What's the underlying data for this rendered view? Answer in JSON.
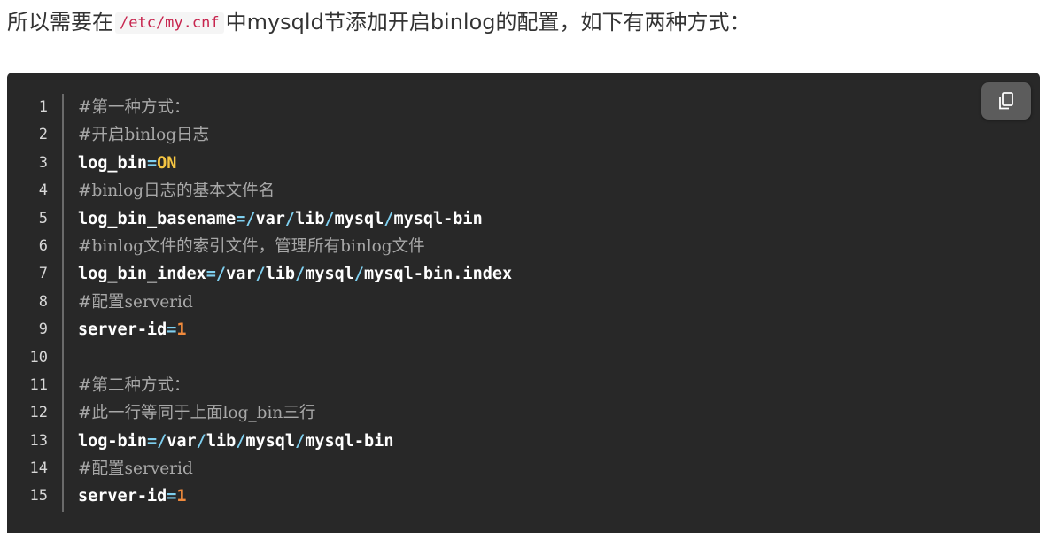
{
  "intro": {
    "before": "所以需要在",
    "code": "/etc/my.cnf",
    "after": "中mysqld节添加开启binlog的配置，如下有两种方式："
  },
  "copy_button": {
    "icon": "copy-icon"
  },
  "code_lines": [
    {
      "num": "1",
      "tokens": [
        {
          "t": "comment",
          "v": "#第一种方式："
        }
      ]
    },
    {
      "num": "2",
      "tokens": [
        {
          "t": "comment",
          "v": "#开启binlog日志"
        }
      ]
    },
    {
      "num": "3",
      "tokens": [
        {
          "t": "key",
          "v": "log_bin"
        },
        {
          "t": "eq",
          "v": "="
        },
        {
          "t": "on",
          "v": "ON"
        }
      ]
    },
    {
      "num": "4",
      "tokens": [
        {
          "t": "comment",
          "v": "#binlog日志的基本文件名"
        }
      ]
    },
    {
      "num": "5",
      "tokens": [
        {
          "t": "key",
          "v": "log_bin_basename"
        },
        {
          "t": "eq",
          "v": "=/"
        },
        {
          "t": "val",
          "v": "var"
        },
        {
          "t": "eq",
          "v": "/"
        },
        {
          "t": "val",
          "v": "lib"
        },
        {
          "t": "eq",
          "v": "/"
        },
        {
          "t": "val",
          "v": "mysql"
        },
        {
          "t": "eq",
          "v": "/"
        },
        {
          "t": "val",
          "v": "mysql-bin"
        }
      ]
    },
    {
      "num": "6",
      "tokens": [
        {
          "t": "comment",
          "v": "#binlog文件的索引文件，管理所有binlog文件"
        }
      ]
    },
    {
      "num": "7",
      "tokens": [
        {
          "t": "key",
          "v": "log_bin_index"
        },
        {
          "t": "eq",
          "v": "=/"
        },
        {
          "t": "val",
          "v": "var"
        },
        {
          "t": "eq",
          "v": "/"
        },
        {
          "t": "val",
          "v": "lib"
        },
        {
          "t": "eq",
          "v": "/"
        },
        {
          "t": "val",
          "v": "mysql"
        },
        {
          "t": "eq",
          "v": "/"
        },
        {
          "t": "val",
          "v": "mysql-bin.index"
        }
      ]
    },
    {
      "num": "8",
      "tokens": [
        {
          "t": "comment",
          "v": "#配置serverid"
        }
      ]
    },
    {
      "num": "9",
      "tokens": [
        {
          "t": "key",
          "v": "server-id"
        },
        {
          "t": "eq",
          "v": "="
        },
        {
          "t": "num",
          "v": "1"
        }
      ]
    },
    {
      "num": "10",
      "tokens": []
    },
    {
      "num": "11",
      "tokens": [
        {
          "t": "comment",
          "v": "#第二种方式："
        }
      ]
    },
    {
      "num": "12",
      "tokens": [
        {
          "t": "comment",
          "v": "#此一行等同于上面log_bin三行"
        }
      ]
    },
    {
      "num": "13",
      "tokens": [
        {
          "t": "key",
          "v": "log-bin"
        },
        {
          "t": "eq",
          "v": "=/"
        },
        {
          "t": "val",
          "v": "var"
        },
        {
          "t": "eq",
          "v": "/"
        },
        {
          "t": "val",
          "v": "lib"
        },
        {
          "t": "eq",
          "v": "/"
        },
        {
          "t": "val",
          "v": "mysql"
        },
        {
          "t": "eq",
          "v": "/"
        },
        {
          "t": "val",
          "v": "mysql-bin"
        }
      ]
    },
    {
      "num": "14",
      "tokens": [
        {
          "t": "comment",
          "v": "#配置serverid"
        }
      ]
    },
    {
      "num": "15",
      "tokens": [
        {
          "t": "key",
          "v": "server-id"
        },
        {
          "t": "eq",
          "v": "="
        },
        {
          "t": "num",
          "v": "1"
        }
      ]
    }
  ]
}
